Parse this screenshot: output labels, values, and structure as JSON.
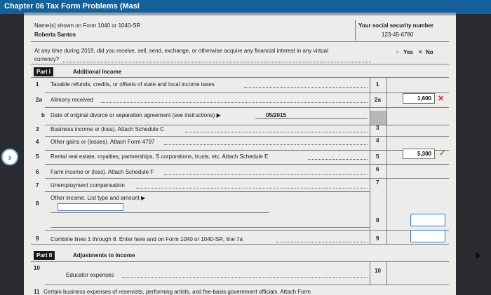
{
  "window": {
    "title": "Chapter 06 Tax Form Problems (Masl"
  },
  "header": {
    "name_label": "Name(s) shown on Form 1040 or 1040-SR",
    "name_value": "Roberta Santos",
    "ssn_label": "Your social security number",
    "ssn_value": "123-45-6780"
  },
  "virtual_currency": {
    "question_line1": "At any time during 2019, did you receive, sell, send, exchange, or otherwise acquire any financial interest in any virtual",
    "question_line2": "currency?",
    "yes_label": "Yes",
    "no_label": "No",
    "yes_mark": "○",
    "no_mark": "✕"
  },
  "part1": {
    "tag": "Part I",
    "title": "Additional Income",
    "lines": [
      {
        "num": "1",
        "text": "Taxable refunds, credits, or offsets of state and local income taxes",
        "box": "1"
      },
      {
        "num": "2a",
        "text": "Alimony received",
        "box": "2a",
        "value": "1,600",
        "status": "incorrect"
      },
      {
        "num": "b",
        "text": "Date of original divorce or separation agreement (see instructions) ▶",
        "date": "05/2015"
      },
      {
        "num": "3",
        "text": "Business income or (loss). Attach Schedule C",
        "box": "3"
      },
      {
        "num": "4",
        "text": "Other gains or (losses). Attach Form 4797",
        "box": "4"
      },
      {
        "num": "5",
        "text": "Rental real estate, royalties, partnerships, S corporations, trusts, etc. Attach Schedule E",
        "box": "5",
        "value": "5,300",
        "status": "correct"
      },
      {
        "num": "6",
        "text": "Farm income or (loss). Attach Schedule F",
        "box": "6"
      },
      {
        "num": "7",
        "text": "Unemployment compensation",
        "box": "7"
      },
      {
        "num": "8",
        "text": "Other income. List type and amount ▶",
        "box": "8"
      },
      {
        "num": "9",
        "text": "Combine lines 1 through 8. Enter here and on Form 1040 or 1040-SR, line 7a",
        "box": "9"
      }
    ]
  },
  "part2": {
    "tag": "Part II",
    "title": "Adjustments to Income",
    "lines": [
      {
        "num": "10",
        "text": "Educator expenses",
        "box": "10"
      },
      {
        "num": "11",
        "text": "Certain business expenses of reservists, performing artists, and fee-basis government officials. Attach Form"
      }
    ]
  },
  "icons": {
    "side_nav": "chevron-right-icon",
    "incorrect": "x-mark-icon",
    "correct": "check-mark-icon"
  },
  "glyphs": {
    "chevron": "›",
    "x": "✕",
    "check": "✓"
  },
  "colors": {
    "titlebar": "#14609a",
    "incorrect": "#d42020",
    "correct": "#3a9a3a",
    "focus_border": "#2f79c5"
  }
}
